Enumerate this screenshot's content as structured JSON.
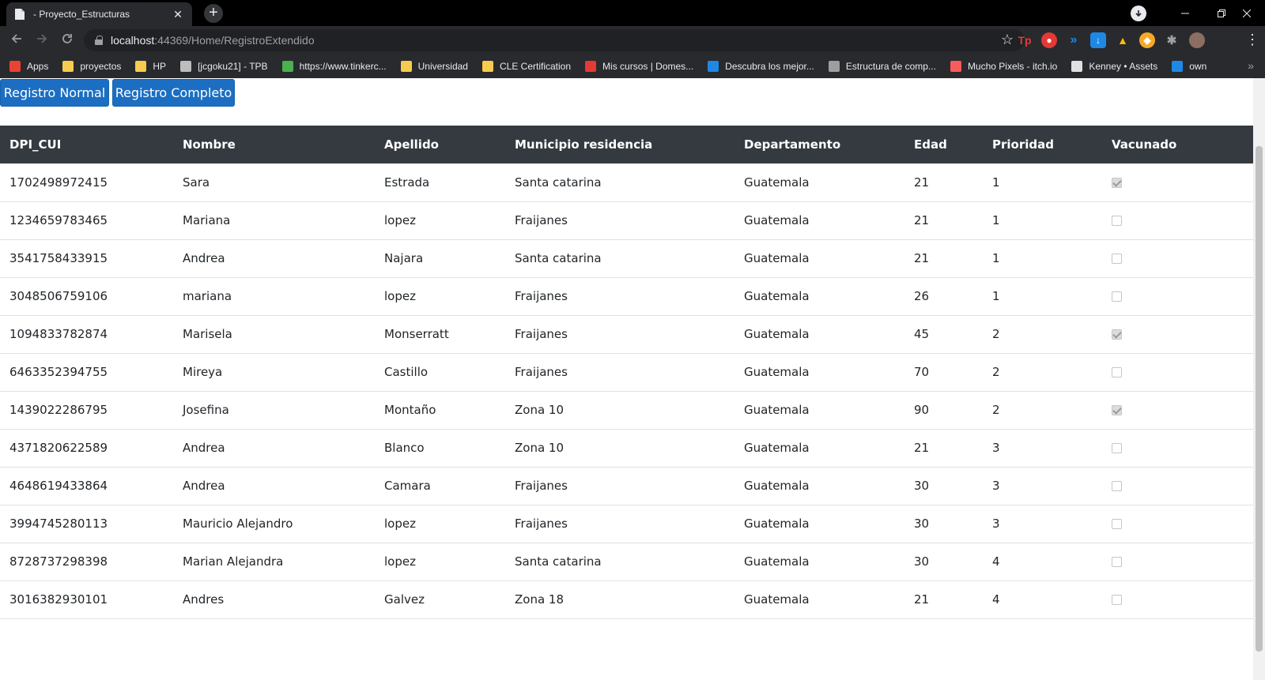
{
  "browser": {
    "tab_title": "- Proyecto_Estructuras",
    "tab_close": "✕",
    "new_tab": "+",
    "url_host": "localhost",
    "url_rest": ":44369/Home/RegistroExtendido"
  },
  "bookmarks": [
    {
      "label": "Apps",
      "icon_color": "#ea4335"
    },
    {
      "label": "proyectos",
      "icon_color": "#f7cb4d"
    },
    {
      "label": "HP",
      "icon_color": "#f7cb4d"
    },
    {
      "label": "[jcgoku21] - TPB",
      "icon_color": "#bdbdbd"
    },
    {
      "label": "https://www.tinkerc...",
      "icon_color": "#4caf50"
    },
    {
      "label": "Universidad",
      "icon_color": "#f7cb4d"
    },
    {
      "label": "CLE Certification",
      "icon_color": "#f7cb4d"
    },
    {
      "label": "Mis cursos | Domes...",
      "icon_color": "#e53935"
    },
    {
      "label": "Descubra los mejor...",
      "icon_color": "#1e88e5"
    },
    {
      "label": "Estructura de comp...",
      "icon_color": "#9e9e9e"
    },
    {
      "label": "Mucho Pixels - itch.io",
      "icon_color": "#fa5c5c"
    },
    {
      "label": "Kenney • Assets",
      "icon_color": "#e0e0e0"
    },
    {
      "label": "own",
      "icon_color": "#1e88e5"
    }
  ],
  "page": {
    "btn_normal": "Registro Normal",
    "btn_completo": "Registro Completo"
  },
  "table": {
    "headers": [
      "DPI_CUI",
      "Nombre",
      "Apellido",
      "Municipio residencia",
      "Departamento",
      "Edad",
      "Prioridad",
      "Vacunado"
    ],
    "rows": [
      {
        "dpi": "1702498972415",
        "nombre": "Sara",
        "apellido": "Estrada",
        "municipio": "Santa catarina",
        "departamento": "Guatemala",
        "edad": "21",
        "prioridad": "1",
        "vacunado": true
      },
      {
        "dpi": "1234659783465",
        "nombre": "Mariana",
        "apellido": "lopez",
        "municipio": "Fraijanes",
        "departamento": "Guatemala",
        "edad": "21",
        "prioridad": "1",
        "vacunado": false
      },
      {
        "dpi": "3541758433915",
        "nombre": "Andrea",
        "apellido": "Najara",
        "municipio": "Santa catarina",
        "departamento": "Guatemala",
        "edad": "21",
        "prioridad": "1",
        "vacunado": false
      },
      {
        "dpi": "3048506759106",
        "nombre": "mariana",
        "apellido": "lopez",
        "municipio": "Fraijanes",
        "departamento": "Guatemala",
        "edad": "26",
        "prioridad": "1",
        "vacunado": false
      },
      {
        "dpi": "1094833782874",
        "nombre": "Marisela",
        "apellido": "Monserratt",
        "municipio": "Fraijanes",
        "departamento": "Guatemala",
        "edad": "45",
        "prioridad": "2",
        "vacunado": true
      },
      {
        "dpi": "6463352394755",
        "nombre": "Mireya",
        "apellido": "Castillo",
        "municipio": "Fraijanes",
        "departamento": "Guatemala",
        "edad": "70",
        "prioridad": "2",
        "vacunado": false
      },
      {
        "dpi": "1439022286795",
        "nombre": "Josefina",
        "apellido": "Montaño",
        "municipio": "Zona 10",
        "departamento": "Guatemala",
        "edad": "90",
        "prioridad": "2",
        "vacunado": true
      },
      {
        "dpi": "4371820622589",
        "nombre": "Andrea",
        "apellido": "Blanco",
        "municipio": "Zona 10",
        "departamento": "Guatemala",
        "edad": "21",
        "prioridad": "3",
        "vacunado": false
      },
      {
        "dpi": "4648619433864",
        "nombre": "Andrea",
        "apellido": "Camara",
        "municipio": "Fraijanes",
        "departamento": "Guatemala",
        "edad": "30",
        "prioridad": "3",
        "vacunado": false
      },
      {
        "dpi": "3994745280113",
        "nombre": "Mauricio Alejandro",
        "apellido": "lopez",
        "municipio": "Fraijanes",
        "departamento": "Guatemala",
        "edad": "30",
        "prioridad": "3",
        "vacunado": false
      },
      {
        "dpi": "8728737298398",
        "nombre": "Marian Alejandra",
        "apellido": "lopez",
        "municipio": "Santa catarina",
        "departamento": "Guatemala",
        "edad": "30",
        "prioridad": "4",
        "vacunado": false
      },
      {
        "dpi": "3016382930101",
        "nombre": "Andres",
        "apellido": "Galvez",
        "municipio": "Zona 18",
        "departamento": "Guatemala",
        "edad": "21",
        "prioridad": "4",
        "vacunado": false
      }
    ]
  }
}
